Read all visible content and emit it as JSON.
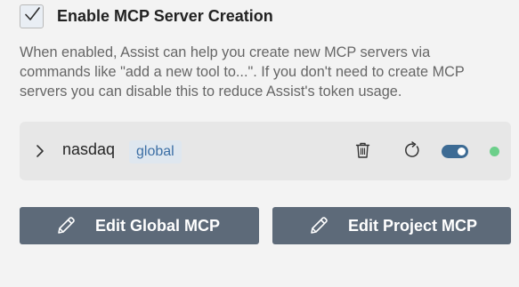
{
  "settings": {
    "enable_mcp_creation": {
      "label": "Enable MCP Server Creation",
      "checked": true
    },
    "description": "When enabled, Assist can help you create new MCP servers via commands like \"add a new tool to...\". If you don't need to create MCP servers you can disable this to reduce Assist's token usage."
  },
  "server": {
    "name": "nasdaq",
    "scope": "global",
    "enabled": true,
    "status_color": "#6ccf8a",
    "icons": [
      "chevron-right-icon",
      "trash-icon",
      "refresh-icon"
    ]
  },
  "buttons": {
    "edit_global": "Edit Global MCP",
    "edit_project": "Edit Project MCP",
    "icon": "pencil-icon"
  },
  "colors": {
    "accent": "#3d6b94",
    "button_bg": "#5d6a79",
    "badge_text": "#3c6fa5"
  }
}
